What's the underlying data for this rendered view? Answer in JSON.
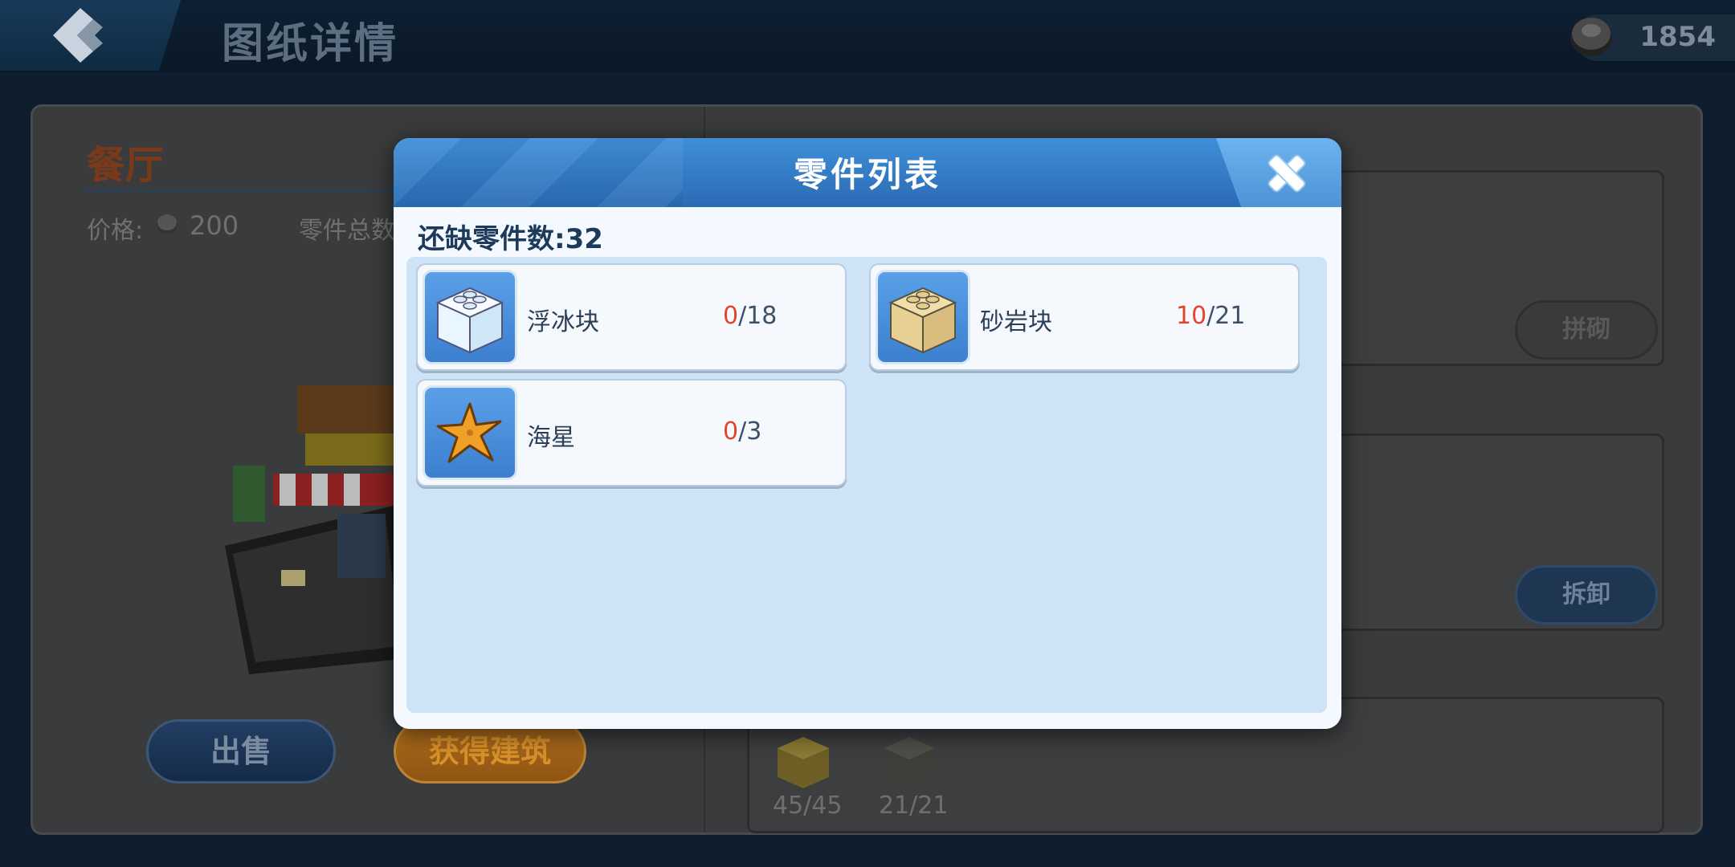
{
  "header": {
    "title": "图纸详情",
    "currency_amount": "1854"
  },
  "building": {
    "name": "餐厅",
    "price_label": "价格:",
    "price_value": "200",
    "parts_total_label": "零件总数"
  },
  "actions": {
    "sell_label": "出售",
    "obtain_label": "获得建筑",
    "assemble_label": "拼砌",
    "disassemble_label": "拆卸"
  },
  "background_blocks": [
    {
      "count": "45/45",
      "color": "#7b6a2a"
    },
    {
      "count": "21/21",
      "color": "#4a4a44"
    }
  ],
  "modal": {
    "title": "零件列表",
    "missing_label": "还缺零件数:",
    "missing_count": "32",
    "parts": [
      {
        "name": "浮冰块",
        "have": "0",
        "need": "/18",
        "icon": "ice-block-icon"
      },
      {
        "name": "砂岩块",
        "have": "10",
        "need": "/21",
        "icon": "sandstone-block-icon"
      },
      {
        "name": "海星",
        "have": "0",
        "need": "/3",
        "icon": "starfish-icon"
      }
    ]
  },
  "colors": {
    "accent_blue": "#2a6bb4",
    "shortage_red": "#e0462a"
  }
}
